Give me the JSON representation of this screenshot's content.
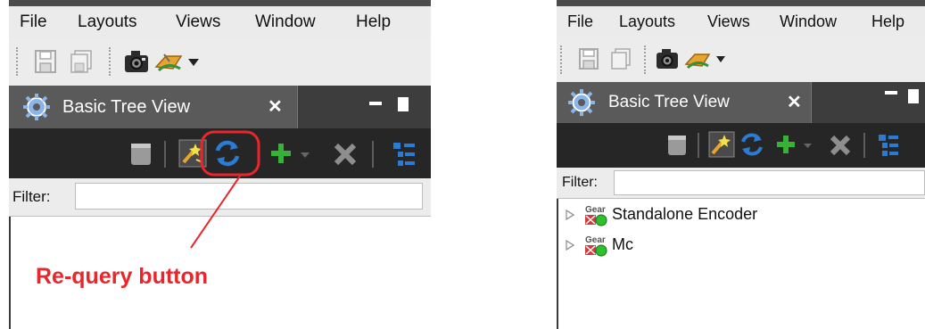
{
  "left": {
    "menu": [
      "File",
      "Layouts",
      "Views",
      "Window",
      "Help"
    ],
    "view_tab_title": "Basic Tree View",
    "view_tab_close": "✕",
    "filter_label": "Filter:",
    "filter_value": "",
    "annotation": "Re-query button"
  },
  "right": {
    "menu": [
      "File",
      "Layouts",
      "Views",
      "Window",
      "Help"
    ],
    "view_tab_title": "Basic Tree View",
    "view_tab_close": "✕",
    "filter_label": "Filter:",
    "filter_value": "",
    "tree": [
      {
        "badge": "Gear",
        "label": "Standalone Encoder"
      },
      {
        "badge": "Gear",
        "label": "Mc"
      }
    ]
  },
  "colors": {
    "annotation": "#e8262c",
    "view_toolbar": "#262626",
    "tab_bar": "#3d3d3d",
    "accent_blue": "#2b7bd3",
    "add_green": "#36b236"
  }
}
